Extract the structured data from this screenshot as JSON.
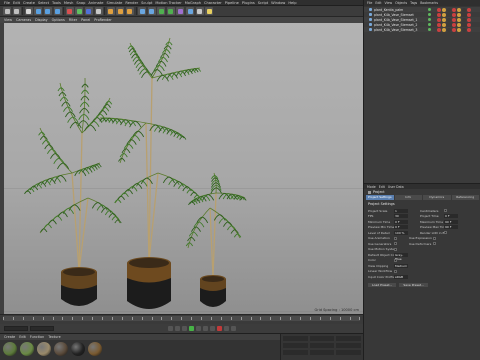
{
  "menubar": {
    "items": [
      "File",
      "Edit",
      "Create",
      "Select",
      "Tools",
      "Mesh",
      "Snap",
      "Animate",
      "Simulate",
      "Render",
      "Sculpt",
      "Motion Tracker",
      "MoGraph",
      "Character",
      "Pipeline",
      "Plugins",
      "Script",
      "Window",
      "Help"
    ]
  },
  "toolbar": {
    "buttons": [
      {
        "icon": "undo-icon",
        "color": "#bfbfbf"
      },
      {
        "icon": "redo-icon",
        "color": "#bfbfbf"
      },
      {
        "icon": "live-selection-icon",
        "color": "#d8d8d8"
      },
      {
        "icon": "move-icon",
        "color": "#5aa0e0"
      },
      {
        "icon": "scale-icon",
        "color": "#5aa0e0"
      },
      {
        "icon": "rotate-icon",
        "color": "#5aa0e0"
      },
      {
        "icon": "x-axis-icon",
        "color": "#d85050"
      },
      {
        "icon": "y-axis-icon",
        "color": "#60c060"
      },
      {
        "icon": "z-axis-icon",
        "color": "#5070d8"
      },
      {
        "icon": "world-coord-icon",
        "color": "#c8c8c8"
      },
      {
        "icon": "render-view-icon",
        "color": "#e0a040"
      },
      {
        "icon": "render-picture-viewer-icon",
        "color": "#e0a040"
      },
      {
        "icon": "render-settings-icon",
        "color": "#e0a040"
      },
      {
        "icon": "cube-icon",
        "color": "#6aa6e0"
      },
      {
        "icon": "pen-icon",
        "color": "#6aa6e0"
      },
      {
        "icon": "subdivision-icon",
        "color": "#50b050"
      },
      {
        "icon": "cloner-icon",
        "color": "#50b050"
      },
      {
        "icon": "deformer-icon",
        "color": "#a070d0"
      },
      {
        "icon": "floor-icon",
        "color": "#6aa6e0"
      },
      {
        "icon": "camera-icon",
        "color": "#c8c8c8"
      },
      {
        "icon": "light-icon",
        "color": "#e8d060"
      }
    ]
  },
  "viewport": {
    "menu": [
      "View",
      "Cameras",
      "Display",
      "Options",
      "Filter",
      "Panel",
      "ProRender"
    ],
    "status": "Grid Spacing : 10000 cm"
  },
  "timeline": {
    "start": "0 F",
    "end": "90 F"
  },
  "materials": {
    "menu": [
      "Create",
      "Edit",
      "Function",
      "Texture"
    ],
    "swatches": [
      {
        "name": "swatch-leaf",
        "color": "#5c7a3a"
      },
      {
        "name": "swatch-leaf-2",
        "color": "#6a8a44"
      },
      {
        "name": "swatch-trunk",
        "color": "#9a8a6a"
      },
      {
        "name": "swatch-soil",
        "color": "#5a4a3a"
      },
      {
        "name": "swatch-pot",
        "color": "#222222"
      },
      {
        "name": "swatch-gold",
        "color": "#7a5a30"
      }
    ]
  },
  "object_manager": {
    "menu": [
      "File",
      "Edit",
      "View",
      "Objects",
      "Tags",
      "Bookmarks"
    ],
    "objects": [
      {
        "name": "plant_Kentia_palm"
      },
      {
        "name": "plant_K4b_Vase_Stemset"
      },
      {
        "name": "plant_K4b_Vase_Stemset_1"
      },
      {
        "name": "plant_K4b_Vase_Stemset_2"
      },
      {
        "name": "plant_K4b_Vase_Stemset_3"
      }
    ]
  },
  "attribute_manager": {
    "menu": [
      "Mode",
      "Edit",
      "User Data"
    ],
    "title": "Project",
    "tabs": [
      "Project Settings",
      "Info",
      "Dynamics",
      "Referencing"
    ],
    "section": "Project Settings",
    "rows": [
      {
        "label": "Project Scale",
        "value": "1",
        "label2": "Centimeters",
        "value2": ""
      },
      {
        "label": "FPS",
        "value": "30",
        "label2": "Project Time",
        "value2": "0 F"
      },
      {
        "label": "Minimum Time",
        "value": "0 F",
        "label2": "Maximum Time",
        "value2": "90 F"
      },
      {
        "label": "Preview Min Time",
        "value": "0 F",
        "label2": "Preview Max Time",
        "value2": "90 F"
      },
      {
        "label": "Level of Detail",
        "value": "100 %",
        "label2": "Render LOD in Editor",
        "value2": ""
      },
      {
        "label": "Use Animation",
        "value": "",
        "label2": "Use Expression",
        "value2": ""
      },
      {
        "label": "Use Generators",
        "value": "",
        "label2": "Use Deformers",
        "value2": ""
      },
      {
        "label": "Use Motion System",
        "value": "",
        "label2": "",
        "value2": ""
      },
      {
        "label": "Default Object Color",
        "value": "Gray-Blue",
        "label2": "",
        "value2": ""
      },
      {
        "label": "Color",
        "value": "",
        "label2": "",
        "value2": ""
      },
      {
        "label": "View Clipping",
        "value": "Medium",
        "label2": "",
        "value2": ""
      },
      {
        "label": "Linear Workflow",
        "value": "",
        "label2": "",
        "value2": ""
      },
      {
        "label": "Input Color Profile",
        "value": "sRGB",
        "label2": "",
        "value2": ""
      }
    ],
    "buttons": [
      "Load Preset...",
      "Save Preset..."
    ]
  }
}
